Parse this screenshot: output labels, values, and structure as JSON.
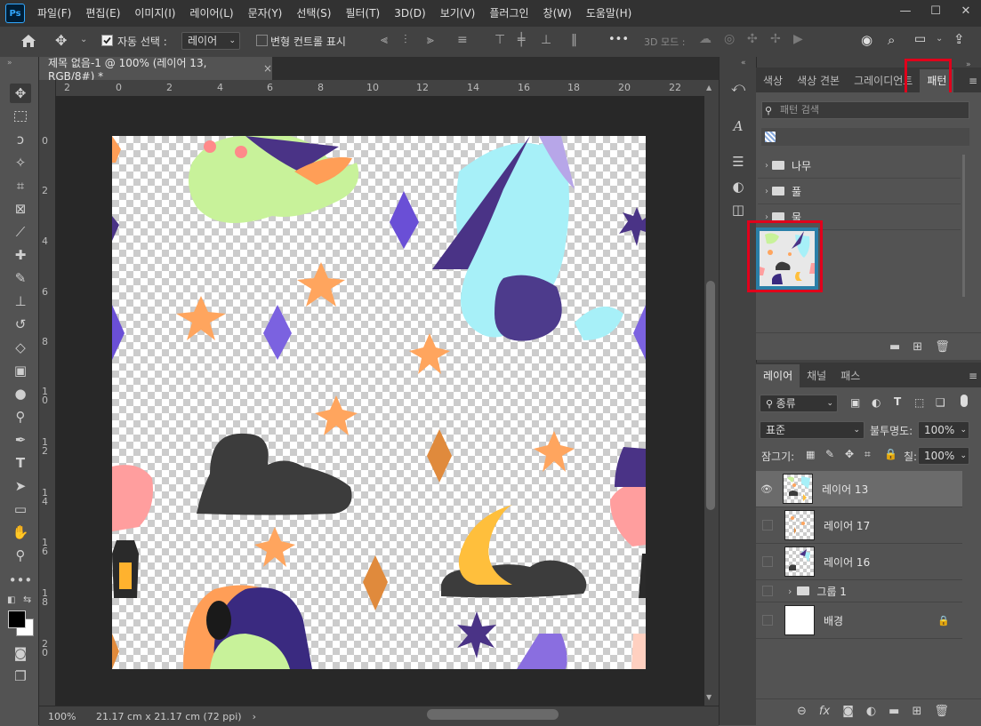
{
  "app": {
    "logo": "Ps",
    "menu": [
      "파일(F)",
      "편집(E)",
      "이미지(I)",
      "레이어(L)",
      "문자(Y)",
      "선택(S)",
      "필터(T)",
      "3D(D)",
      "보기(V)",
      "플러그인",
      "창(W)",
      "도움말(H)"
    ],
    "window_controls": [
      "minimize-icon",
      "maximize-icon",
      "close-icon"
    ]
  },
  "options_bar": {
    "auto_select_label": "자동 선택 :",
    "auto_select_checked": true,
    "auto_select_value": "레이어",
    "transform_label": "변형 컨트롤 표시",
    "transform_checked": false,
    "more": "•••",
    "mode_3d_label": "3D 모드 :"
  },
  "document": {
    "tab_title": "제목 없음-1 @ 100% (레이어 13, RGB/8#) *",
    "close": "×",
    "ruler_top": [
      "2",
      "0",
      "2",
      "4",
      "6",
      "8",
      "10",
      "12",
      "14",
      "16",
      "18",
      "20",
      "22"
    ],
    "ruler_left": [
      "0",
      "2",
      "4",
      "6",
      "8",
      "10",
      "12",
      "14",
      "16",
      "18",
      "20"
    ]
  },
  "status_bar": {
    "zoom": "100%",
    "doc_size": "21.17 cm x 21.17 cm (72 ppi)",
    "arrow": "›"
  },
  "pattern_panel": {
    "tabs": [
      "색상",
      "색상 견본",
      "그레이디언트",
      "패턴"
    ],
    "active_tab": 3,
    "search_placeholder": "패턴 검색",
    "folders": [
      "나무",
      "풀",
      "물"
    ]
  },
  "layers_panel": {
    "tabs": [
      "레이어",
      "채널",
      "패스"
    ],
    "active_tab": 0,
    "filter_value": "종류",
    "blend_mode": "표준",
    "opacity_label": "불투명도:",
    "opacity_value": "100%",
    "lock_label": "잠그기:",
    "fill_label": "칠:",
    "fill_value": "100%",
    "layers": [
      {
        "name": "레이어 13",
        "visible": true,
        "selected": true
      },
      {
        "name": "레이어 17",
        "visible": false,
        "selected": false
      },
      {
        "name": "레이어 16",
        "visible": false,
        "selected": false
      },
      {
        "name": "그룹 1",
        "visible": false,
        "selected": false,
        "group": true
      },
      {
        "name": "배경",
        "visible": false,
        "selected": false,
        "background": true
      }
    ]
  },
  "colors": {
    "highlight": "#e0001b",
    "ps_blue": "#31a8ff"
  }
}
